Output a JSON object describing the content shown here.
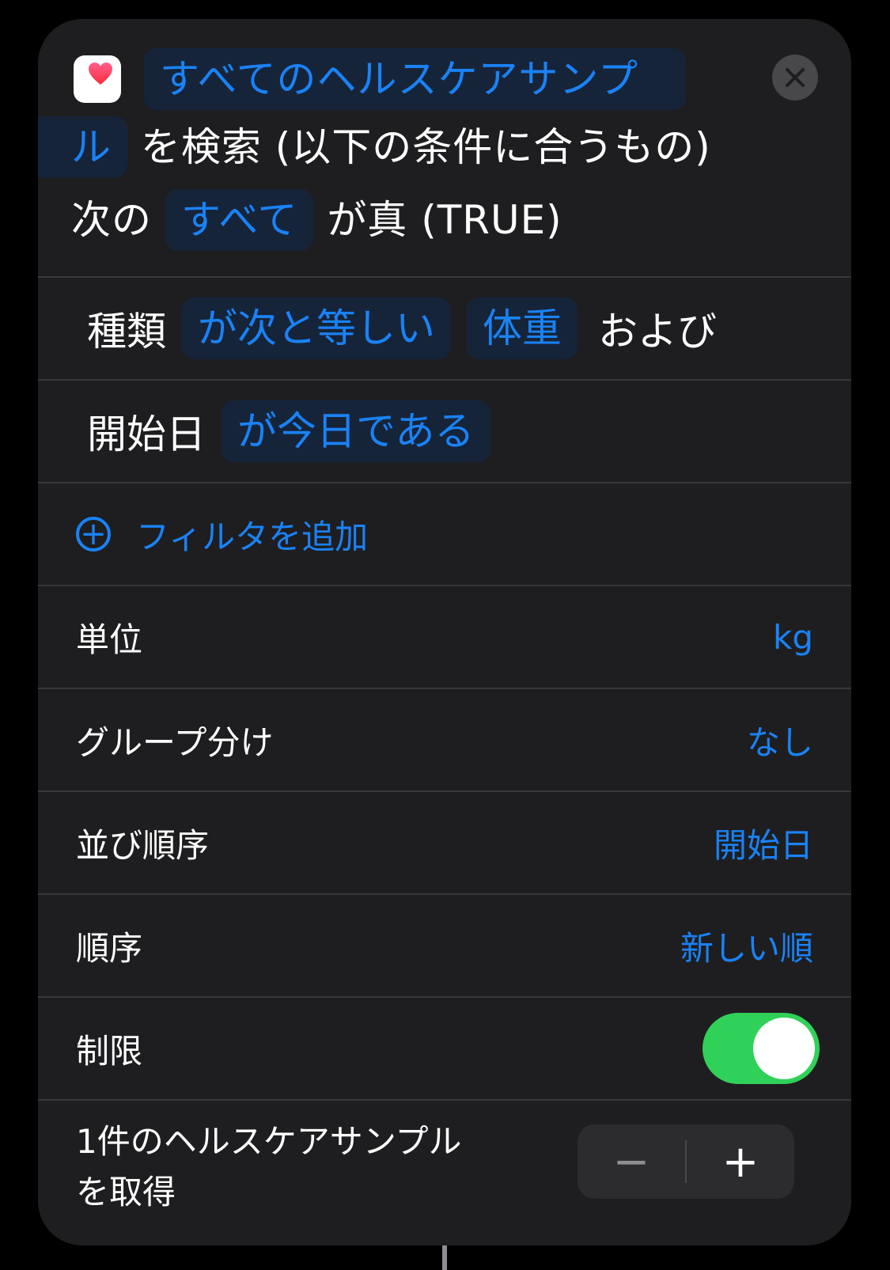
{
  "action": {
    "app_icon": "health-heart-icon",
    "title_token_part1": "すべてのヘルスケアサンプ",
    "title_token_part2": "ル",
    "title_suffix": "を検索 (以下の条件に合うもの)",
    "condition_prefix": "次の",
    "condition_token": "すべて",
    "condition_suffix": "が真 (TRUE)",
    "close_icon": "close-icon"
  },
  "filters": [
    {
      "field": "種類",
      "operator": "が次と等しい",
      "value": "体重",
      "conjunction": "および"
    },
    {
      "field": "開始日",
      "operator": "が今日である"
    }
  ],
  "add_filter_label": "フィルタを追加",
  "settings": [
    {
      "label": "単位",
      "value": "kg"
    },
    {
      "label": "グループ分け",
      "value": "なし"
    },
    {
      "label": "並び順序",
      "value": "開始日"
    },
    {
      "label": "順序",
      "value": "新しい順"
    }
  ],
  "limit": {
    "label": "制限",
    "enabled": true
  },
  "limit_count": {
    "label_line1": "1件のヘルスケアサンプル",
    "label_line2": "を取得",
    "minus": "−",
    "plus": "+"
  },
  "colors": {
    "accent": "#1a82f5",
    "toggle_on": "#30d158",
    "card_bg": "#1e1e20"
  }
}
